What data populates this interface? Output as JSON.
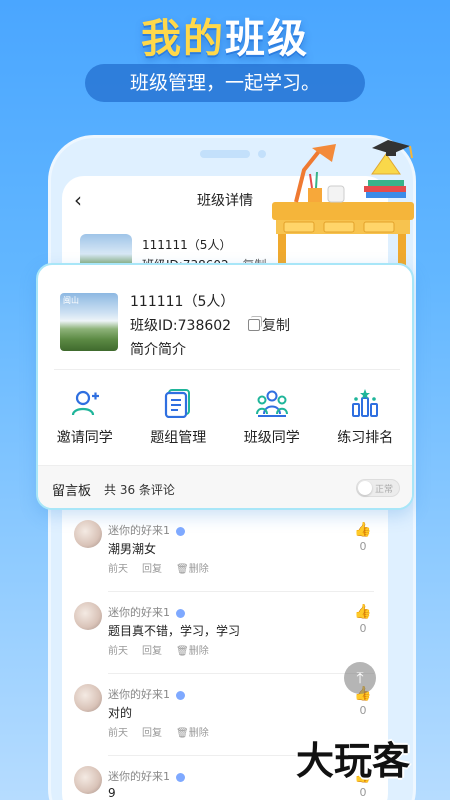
{
  "hero": {
    "title_a": "我的",
    "title_b": "班级",
    "subtitle": "班级管理，一起学习。"
  },
  "screen": {
    "back_icon": "‹",
    "title": "班级详情",
    "bg_card": {
      "name": "111111（5人）",
      "id": "班级ID:738602",
      "copy": "复制"
    }
  },
  "card": {
    "thumb_mark": "闽山",
    "name": "111111（5人）",
    "id": "班级ID:738602",
    "copy_label": "复制",
    "intro": "简介简介",
    "actions": [
      {
        "label": "邀请同学",
        "icon": "invite-user-icon"
      },
      {
        "label": "题组管理",
        "icon": "question-set-icon"
      },
      {
        "label": "班级同学",
        "icon": "classmates-icon"
      },
      {
        "label": "练习排名",
        "icon": "ranking-icon"
      }
    ],
    "board": {
      "title": "留言板",
      "count": "共 36 条评论",
      "toggle_label": "正常"
    }
  },
  "comments": [
    {
      "name": "迷你的好来1",
      "text": "潮男潮女",
      "time": "前天",
      "reply": "回复",
      "delete": "删除",
      "likes": "0"
    },
    {
      "name": "迷你的好来1",
      "text": "题目真不错，学习，学习",
      "time": "前天",
      "reply": "回复",
      "delete": "删除",
      "likes": "0"
    },
    {
      "name": "迷你的好来1",
      "text": "对的",
      "time": "前天",
      "reply": "回复",
      "delete": "删除",
      "likes": "0"
    },
    {
      "name": "迷你的好来1",
      "text": "9",
      "time": "",
      "reply": "",
      "delete": "",
      "likes": "0"
    }
  ],
  "fab_icon": "⤒",
  "watermark": "大玩客",
  "colors": {
    "brand_blue": "#4aa6ff",
    "accent_yellow": "#ffd84a",
    "card_border": "#a8e6f8",
    "icon_blue": "#2f6fe0",
    "icon_teal": "#1fb59a"
  }
}
